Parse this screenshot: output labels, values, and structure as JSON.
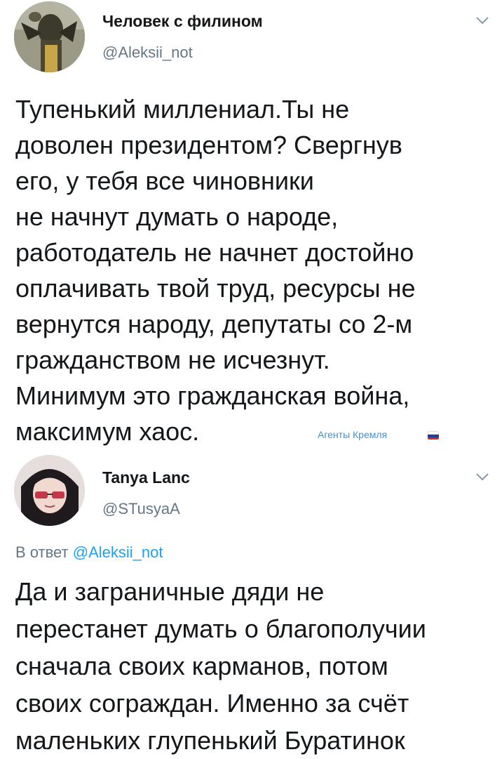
{
  "tweets": [
    {
      "display_name": "Человек с филином",
      "handle": "@Aleksii_not",
      "text": "Тупенький миллениал.Ты не\nдоволен президентом? Свергнув\nего, у тебя все чиновники\nне начнут думать о народе,\nработодатель не начнет достойно\nоплачивать твой труд, ресурсы не\nвернутся народу, депутаты со 2-м\nгражданством не исчезнут.\nМинимум это гражданская война,\nмаксимум хаос."
    },
    {
      "display_name": "Tanya Lanc",
      "handle": "@STusyaA",
      "reply_prefix": "В ответ",
      "reply_mention": "@Aleksii_not",
      "text": "Да и заграничные дяди не\nперестанет думать о благополучии\nсначала своих карманов, потом\nсвоих сограждан. Именно за счёт\nмаленьких глупенький Буратинок"
    }
  ],
  "watermark": {
    "text": "Агенты Кремля",
    "flag_colors": [
      "#ffffff",
      "#1c3f9e",
      "#d52b1e"
    ]
  },
  "icons": {
    "menu": "chevron-down-icon",
    "avatar_1": "owl-man-avatar",
    "avatar_2": "anime-girl-avatar"
  },
  "colors": {
    "text": "#14171a",
    "secondary": "#657786",
    "link": "#1da1f2"
  }
}
